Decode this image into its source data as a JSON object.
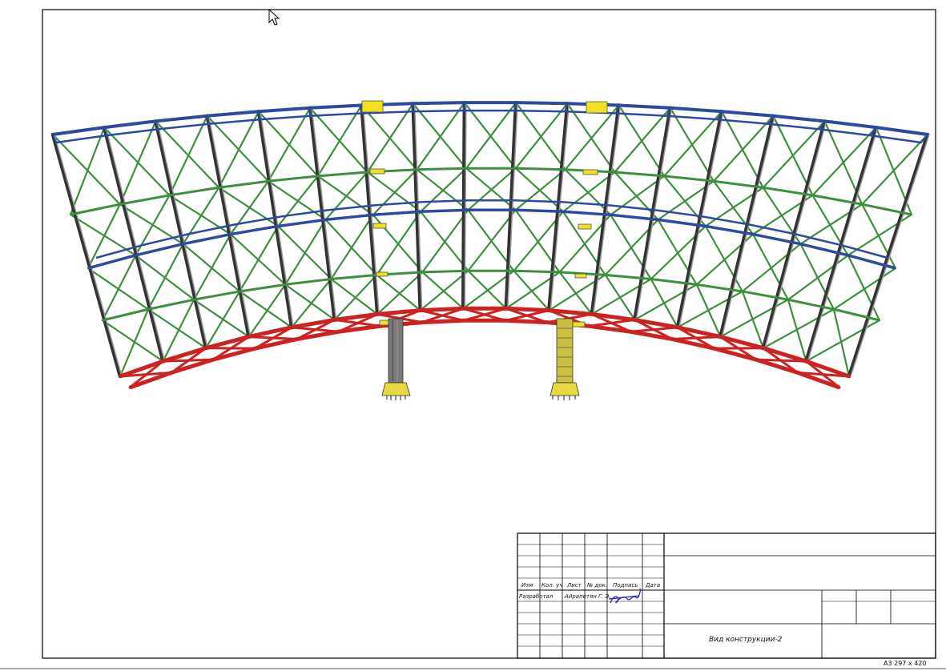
{
  "title_block": {
    "headers": [
      "Изм",
      "Кол. уч",
      "Лист",
      "№ док.",
      "Подпись",
      "Дата"
    ],
    "developer_role": "Разработал",
    "developer_name": "Айрапетян Г. Э.",
    "drawing_title": "Вид конструкции-2"
  },
  "sheet_format": "A3 297 x 420",
  "colors": {
    "top_chord": "#2b4aa0",
    "diagonals": "#3c8f3c",
    "bottom_chord": "#cc2222",
    "columns": "#555555",
    "plates": "#f0e020"
  },
  "icons": [
    "cursor-arrow-icon"
  ]
}
